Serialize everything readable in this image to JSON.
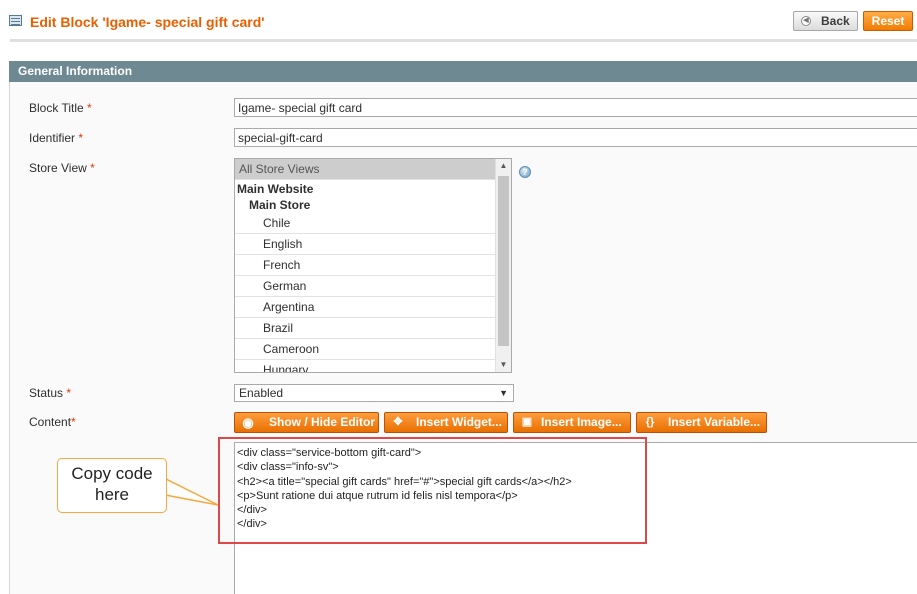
{
  "header": {
    "title": "Edit Block 'Igame- special gift card'",
    "back_label": "Back",
    "reset_label": "Reset"
  },
  "section": {
    "title": "General Information"
  },
  "form": {
    "block_title": {
      "label": "Block Title",
      "required": "*",
      "value": "Igame- special gift card"
    },
    "identifier": {
      "label": "Identifier",
      "required": "*",
      "value": "special-gift-card"
    },
    "store_view": {
      "label": "Store View",
      "required": "*",
      "options": {
        "all": "All Store Views",
        "website": "Main Website",
        "store": "Main Store",
        "views": [
          "Chile",
          "English",
          "French",
          "German",
          "Argentina",
          "Brazil",
          "Cameroon",
          "Hungary"
        ]
      }
    },
    "status": {
      "label": "Status",
      "required": "*",
      "value": "Enabled"
    },
    "content": {
      "label": "Content",
      "required": "*",
      "buttons": {
        "show_hide": "Show / Hide Editor",
        "widget": "Insert Widget...",
        "image": "Insert Image...",
        "variable": "Insert Variable..."
      },
      "code_lines": [
        "<div class=\"service-bottom gift-card\">",
        "<div class=\"info-sv\">",
        "<h2><a title=\"special gift cards\" href=\"#\">special gift cards</a></h2>",
        "<p>Sunt ratione dui atque rutrum id felis nisl tempora</p>",
        "</div>",
        "</div>"
      ]
    }
  },
  "callout": {
    "line1": "Copy code",
    "line2": "here"
  },
  "colors": {
    "accent": "#eb5e00",
    "section_header": "#6f8992",
    "highlight_border": "#dd4848",
    "callout_border": "#f7a73c"
  }
}
